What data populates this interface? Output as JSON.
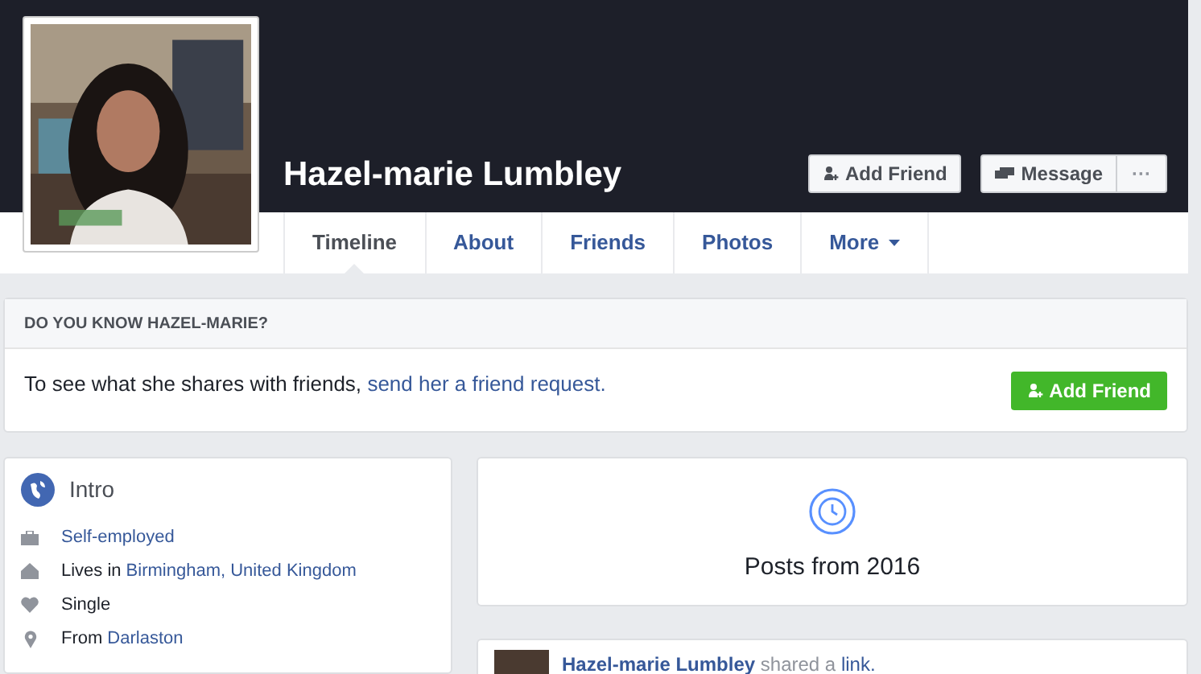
{
  "profile": {
    "name": "Hazel-marie Lumbley",
    "actions": [
      {
        "label": "Add Friend",
        "kind": "add"
      },
      {
        "label": "Message",
        "kind": "message"
      },
      {
        "label": "···",
        "kind": "more"
      }
    ]
  },
  "tabs": [
    {
      "label": "Timeline",
      "selected": true,
      "dropdown": false
    },
    {
      "label": "About",
      "selected": false,
      "dropdown": false
    },
    {
      "label": "Friends",
      "selected": false,
      "dropdown": false
    },
    {
      "label": "Photos",
      "selected": false,
      "dropdown": false
    },
    {
      "label": "More",
      "selected": false,
      "dropdown": true
    }
  ],
  "know_card": {
    "title": "DO YOU KNOW HAZEL-MARIE?",
    "text": "To see what she shares with friends,",
    "link": "send her a friend request.",
    "button": "Add Friend"
  },
  "intro": {
    "title": "Intro",
    "items": [
      {
        "kind": "work",
        "link": "Self-employed"
      },
      {
        "kind": "home",
        "prefix": "Lives in",
        "link": "Birmingham, United Kingdom"
      },
      {
        "kind": "relationship",
        "prefix": "Single"
      },
      {
        "kind": "place",
        "prefix": "From",
        "link": "Darlaston"
      }
    ]
  },
  "posts_header": {
    "title": "Posts from 2016"
  },
  "post": {
    "author": "Hazel-marie Lumbley",
    "action": "shared a",
    "link": "link."
  }
}
